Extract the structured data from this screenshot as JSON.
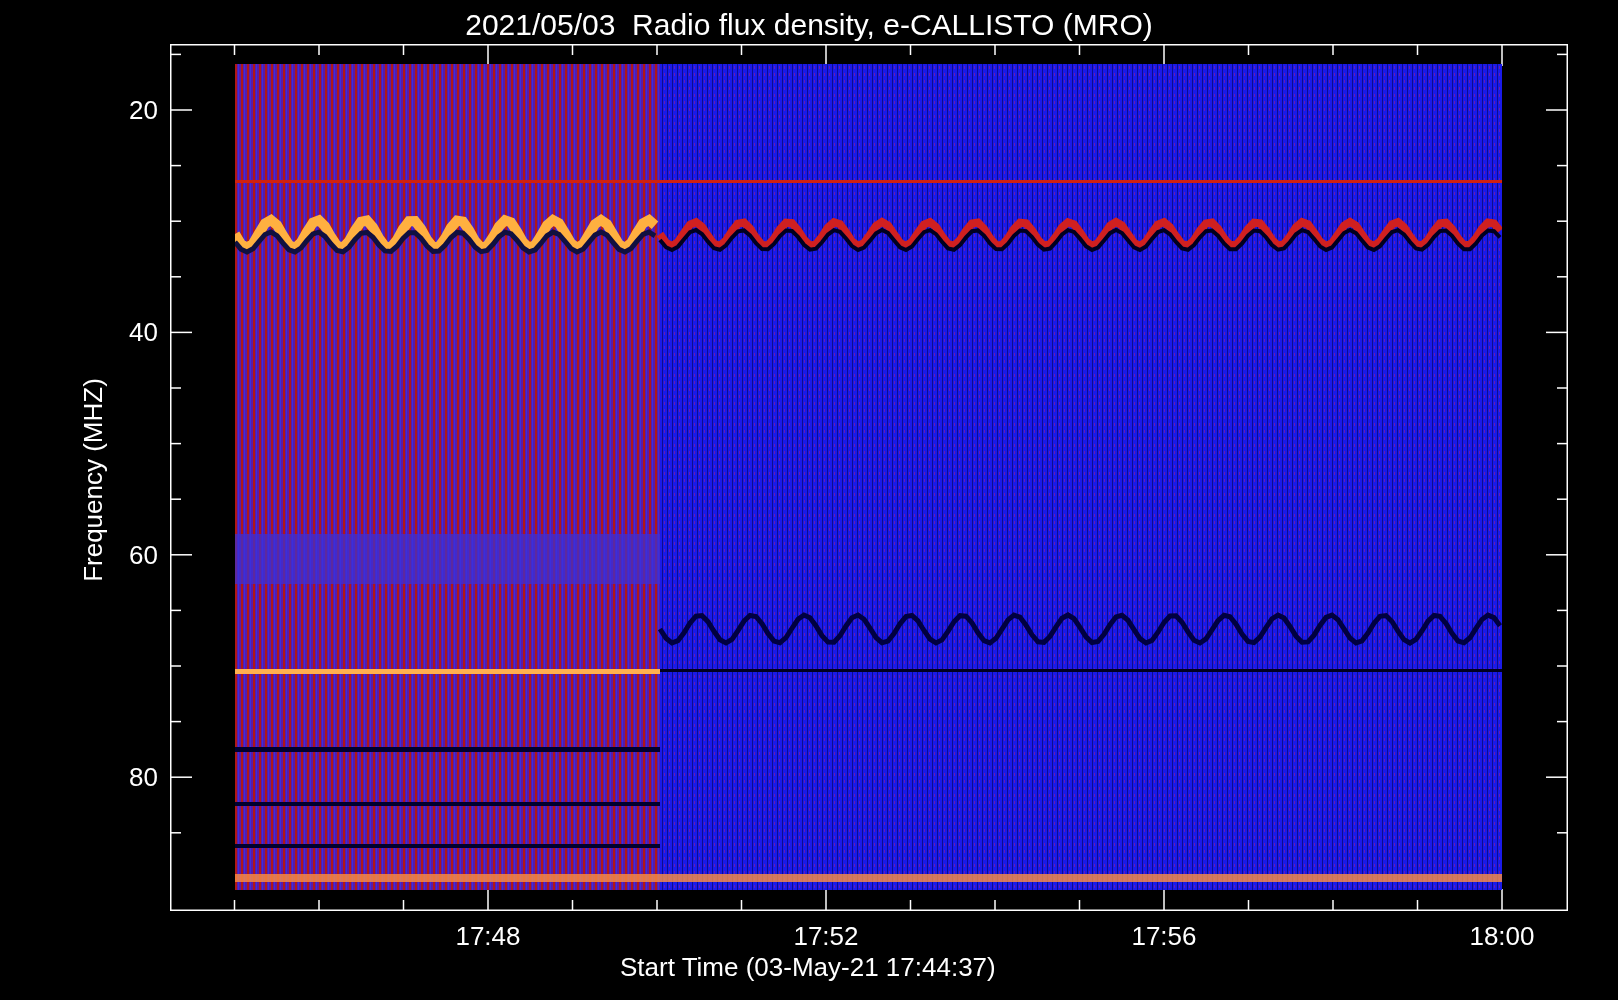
{
  "title": "2021/05/03  Radio flux density, e-CALLISTO (MRO)",
  "y_axis": {
    "label": "Frequency (MHZ)",
    "ticks": [
      "20",
      "40",
      "60",
      "80"
    ]
  },
  "x_axis": {
    "label": "Start Time (03-May-21 17:44:37)",
    "ticks": [
      "17:48",
      "17:52",
      "17:56",
      "18:00"
    ]
  }
}
